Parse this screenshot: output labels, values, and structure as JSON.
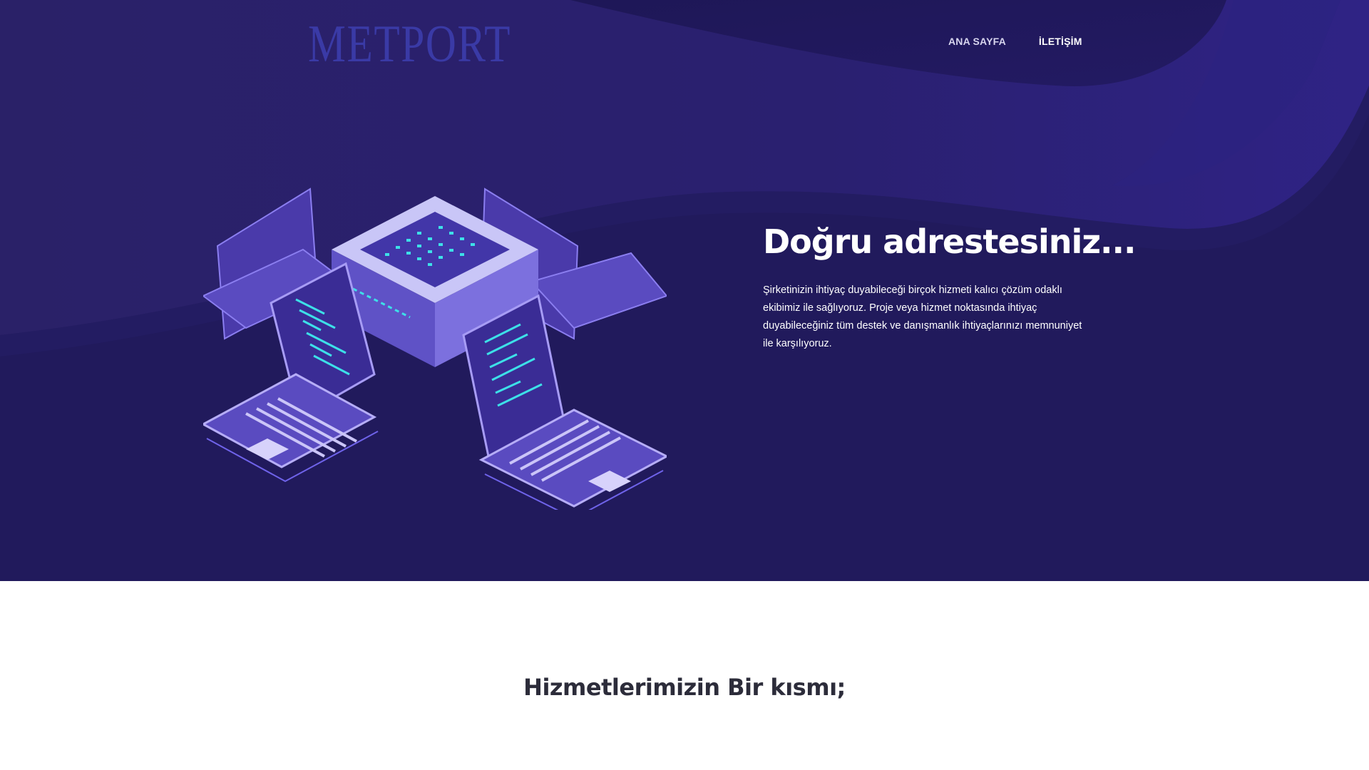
{
  "brand": {
    "logo_text": "METPORT",
    "logo_color": "#3a3aa6"
  },
  "nav": {
    "items": [
      {
        "label": "ANA SAYFA"
      },
      {
        "label": "İLETİŞİM"
      }
    ]
  },
  "hero": {
    "title": "Doğru adrestesiniz...",
    "description": "Şirketinizin ihtiyaç duyabileceği birçok hizmeti kalıcı çözüm odaklı ekibimiz ile sağlıyoruz. Proje veya hizmet noktasında ihtiyaç duyabileceğiniz tüm destek ve danışmanlık ihtiyaçlarınızı memnuniyet ile karşılıyoruz.",
    "background_color": "#221a5e",
    "accent_color": "#3de0e8",
    "illustration_icon": "server-laptops-isometric-icon"
  },
  "services": {
    "title": "Hizmetlerimizin Bir kısmı;"
  }
}
